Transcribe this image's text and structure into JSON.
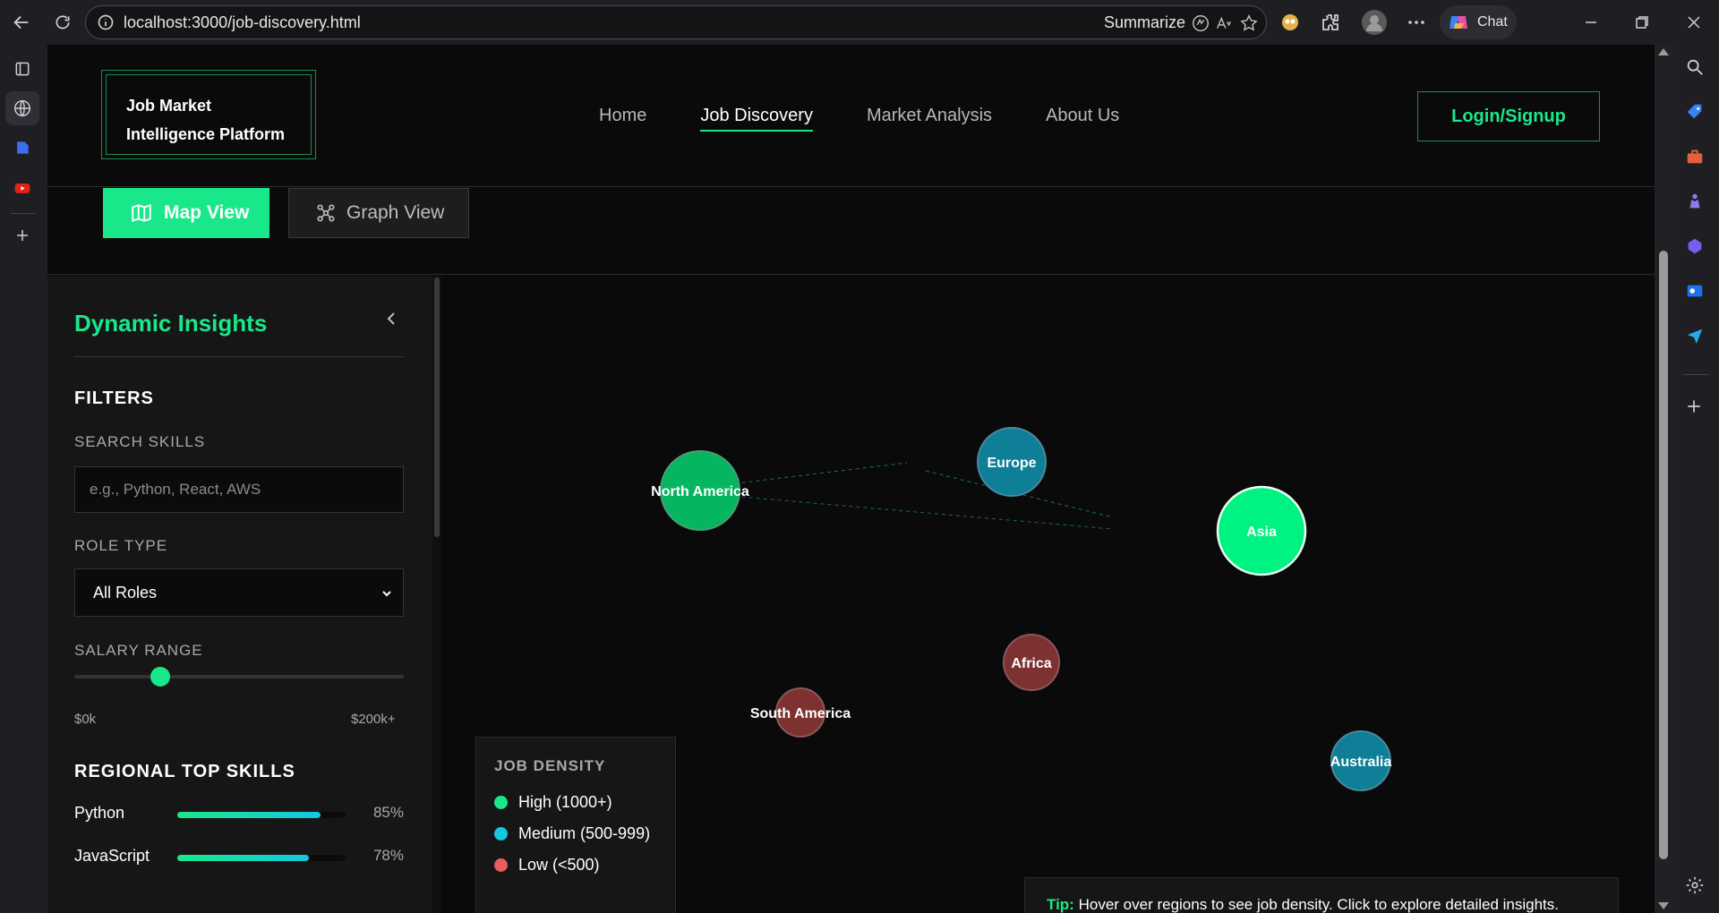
{
  "browser": {
    "url": "localhost:3000/job-discovery.html",
    "summarize_label": "Summarize",
    "chat_label": "Chat"
  },
  "site": {
    "logo_line1": "Job Market",
    "logo_line2": "Intelligence Platform",
    "nav": [
      "Home",
      "Job Discovery",
      "Market Analysis",
      "About Us"
    ],
    "active_nav": "Job Discovery",
    "login_label": "Login/Signup"
  },
  "views": {
    "map_label": "Map View",
    "graph_label": "Graph View",
    "active": "Map View"
  },
  "panel": {
    "title": "Dynamic Insights",
    "filters_heading": "FILTERS",
    "search_label": "SEARCH SKILLS",
    "search_placeholder": "e.g., Python, React, AWS",
    "role_label": "ROLE TYPE",
    "role_value": "All Roles",
    "salary_label": "SALARY RANGE",
    "salary_min": "$0k",
    "salary_max": "$200k+",
    "salary_fraction": 0.26,
    "skills_heading": "REGIONAL TOP SKILLS",
    "skills": [
      {
        "name": "Python",
        "pct_label": "85%",
        "fraction": 0.85
      },
      {
        "name": "JavaScript",
        "pct_label": "78%",
        "fraction": 0.78
      }
    ]
  },
  "map": {
    "regions": [
      {
        "name": "North America",
        "density": "high"
      },
      {
        "name": "Europe",
        "density": "medium"
      },
      {
        "name": "Asia",
        "density": "high"
      },
      {
        "name": "Africa",
        "density": "low"
      },
      {
        "name": "South America",
        "density": "low"
      },
      {
        "name": "Australia",
        "density": "medium"
      }
    ],
    "legend_title": "JOB DENSITY",
    "legend": [
      {
        "label": "High (1000+)",
        "color": "#19e88a"
      },
      {
        "label": "Medium (500-999)",
        "color": "#14c8e0"
      },
      {
        "label": "Low (<500)",
        "color": "#e85c5c"
      }
    ],
    "tip_label": "Tip:",
    "tip_text": "Hover over regions to see job density. Click to explore detailed insights."
  },
  "colors": {
    "accent": "#19e88a",
    "medium": "#0e7f97",
    "low": "#7d3131"
  }
}
